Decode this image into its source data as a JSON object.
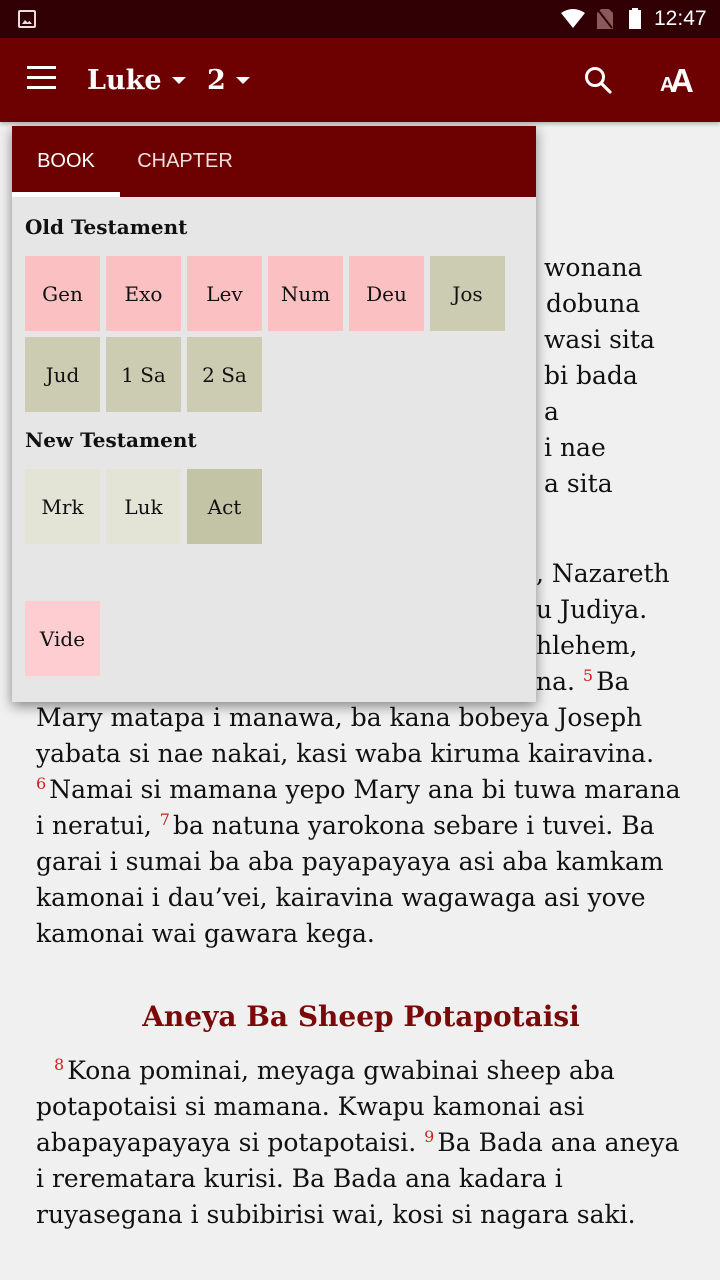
{
  "status_bar": {
    "time": "12:47",
    "icons": [
      "image-notification-icon",
      "wifi-icon",
      "no-sim-icon",
      "battery-icon"
    ]
  },
  "app_bar": {
    "book": "Luke",
    "chapter": "2",
    "icons": [
      "menu-icon",
      "search-icon",
      "font-size-icon"
    ],
    "colors": {
      "primary": "#6d0000",
      "status": "#300004"
    }
  },
  "book_picker": {
    "tabs": [
      {
        "label": "BOOK",
        "selected": true
      },
      {
        "label": "CHAPTER",
        "selected": false
      }
    ],
    "groups": [
      {
        "title": "Old Testament",
        "books": [
          {
            "label": "Gen",
            "color": "#fbc0c2"
          },
          {
            "label": "Exo",
            "color": "#fbc0c2"
          },
          {
            "label": "Lev",
            "color": "#fbc0c2"
          },
          {
            "label": "Num",
            "color": "#fbc0c2"
          },
          {
            "label": "Deu",
            "color": "#fbc0c2"
          },
          {
            "label": "Jos",
            "color": "#ccccb2"
          },
          {
            "label": "Jud",
            "color": "#ccccb2"
          },
          {
            "label": "1 Sa",
            "color": "#ccccb2"
          },
          {
            "label": "2 Sa",
            "color": "#ccccb2"
          }
        ]
      },
      {
        "title": "New Testament",
        "books": [
          {
            "label": "Mrk",
            "color": "#e3e4d6"
          },
          {
            "label": "Luk",
            "color": "#e3e4d6"
          },
          {
            "label": "Act",
            "color": "#c2c4a5"
          }
        ]
      },
      {
        "title": "",
        "books": [
          {
            "label": "Vide",
            "color": "#fdcdd2"
          }
        ]
      }
    ]
  },
  "reader": {
    "visible_right_fragments": [
      "wonana",
      "dobuna",
      "wasi sita",
      "bi bada",
      "a",
      "i nae",
      "a sita"
    ],
    "para1_fragments": [
      ", Nazareth",
      "u Judiya.",
      "hlehem,",
      "na."
    ],
    "verses": [
      {
        "num": "5",
        "text": "Ba Mary matapa i manawa, ba kana bobeya Joseph yabata si nae nakai, kasi waba kiruma kairavina."
      },
      {
        "num": "6",
        "text": "Namai si mamana yepo Mary ana bi tuwa marana i neratui,"
      },
      {
        "num": "7",
        "text": "ba natuna yarokona sebare i tuvei. Ba garai i sumai ba aba payapayaya asi aba kamkam kamonai i dau’vei, kairavina wagawaga asi yove kamonai wai gawara kega."
      }
    ],
    "section_heading": "Aneya Ba Sheep Potapotaisi",
    "verses2": [
      {
        "num": "8",
        "text": "Kona pominai, meyaga gwabinai sheep aba potapotaisi si mamana. Kwapu kamonai asi abapayapayaya si potapotaisi."
      },
      {
        "num": "9",
        "text": "Ba Bada ana aneya i rerematara kurisi. Ba Bada ana kadara i ruyasegana i subibirisi wai, kosi si nagara saki."
      }
    ]
  }
}
